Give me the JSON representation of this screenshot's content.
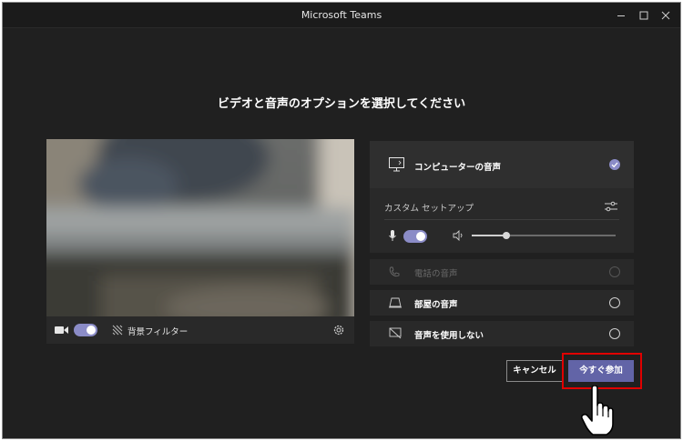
{
  "window": {
    "title": "Microsoft Teams"
  },
  "heading": "ビデオと音声のオプションを選択してください",
  "video_bar": {
    "bg_filter_label": "背景フィルター",
    "camera_on": true
  },
  "audio": {
    "computer": {
      "label": "コンピューターの音声",
      "selected": true
    },
    "custom_setup": {
      "label": "カスタム セットアップ",
      "mic_on": true,
      "speaker_volume": 0.24
    },
    "phone": {
      "label": "電話の音声",
      "disabled": true
    },
    "room": {
      "label": "部屋の音声"
    },
    "none": {
      "label": "音声を使用しない"
    }
  },
  "buttons": {
    "cancel": "キャンセル",
    "join": "今すぐ参加"
  },
  "colors": {
    "accent": "#6264a7",
    "toggle": "#8b8cc7",
    "highlight": "#e00000"
  }
}
